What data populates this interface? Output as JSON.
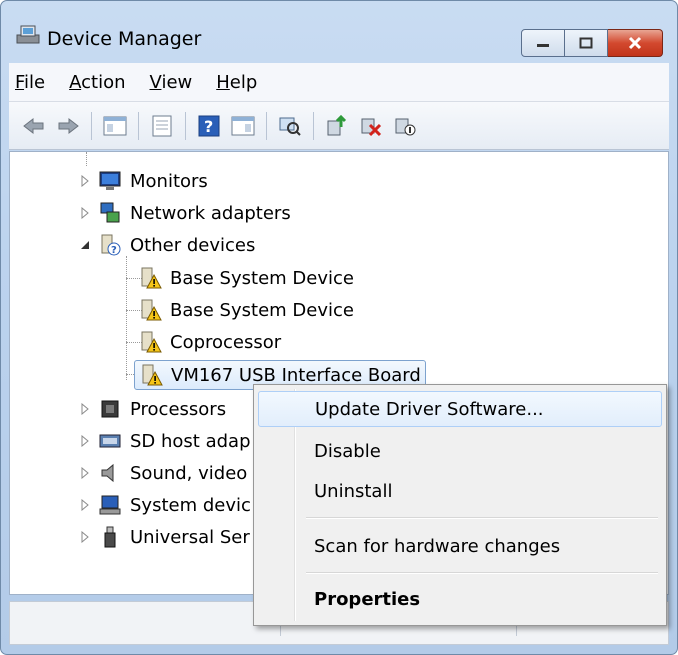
{
  "window": {
    "title": "Device Manager",
    "colors": {
      "titlebar": "#bcd3ee",
      "close_button": "#d3492f",
      "selection_border": "#7da2ce"
    }
  },
  "menubar": [
    {
      "label_first": "F",
      "label_rest": "ile"
    },
    {
      "label_first": "A",
      "label_rest": "ction"
    },
    {
      "label_first": "V",
      "label_rest": "iew"
    },
    {
      "label_first": "H",
      "label_rest": "elp"
    }
  ],
  "toolbar": {
    "icons": [
      "back-arrow-icon",
      "forward-arrow-icon",
      "show-hide-console-tree-icon",
      "properties-icon",
      "help-icon",
      "action-pane-icon",
      "scan-hardware-icon",
      "update-driver-icon",
      "uninstall-icon",
      "disable-device-icon"
    ]
  },
  "tree": {
    "monitors": "Monitors",
    "network": "Network adapters",
    "other": "Other devices",
    "children": [
      "Base System Device",
      "Base System Device",
      "Coprocessor",
      "VM167 USB Interface Board"
    ],
    "processors": "Processors",
    "sd_host": "SD host adap",
    "sound": "Sound, video",
    "system": "System devic",
    "usb": "Universal Ser"
  },
  "context_menu": {
    "update": "Update Driver Software...",
    "disable": "Disable",
    "uninstall": "Uninstall",
    "scan": "Scan for hardware changes",
    "properties": "Properties"
  }
}
